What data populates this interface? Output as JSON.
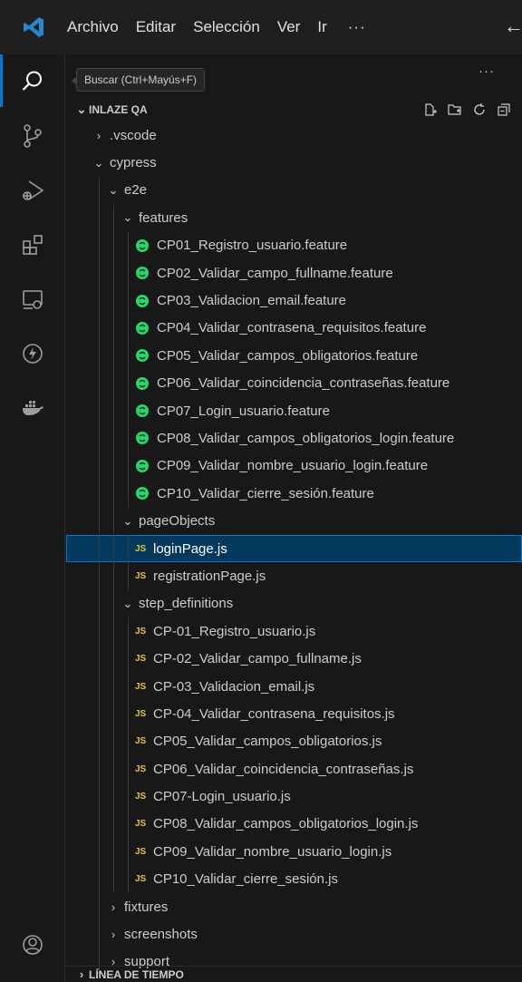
{
  "menu": {
    "items": [
      "Archivo",
      "Editar",
      "Selección",
      "Ver",
      "Ir"
    ],
    "more": "···"
  },
  "tooltip": "Buscar (Ctrl+Mayús+F)",
  "sidebar_more": "···",
  "explorer": {
    "title": "INLAZE QA",
    "rows": [
      {
        "label": ".vscode",
        "type": "folder",
        "expanded": false,
        "depth": 0
      },
      {
        "label": "cypress",
        "type": "folder",
        "expanded": true,
        "depth": 0
      },
      {
        "label": "e2e",
        "type": "folder",
        "expanded": true,
        "depth": 1
      },
      {
        "label": "features",
        "type": "folder",
        "expanded": true,
        "depth": 2
      },
      {
        "label": "CP01_Registro_usuario.feature",
        "type": "feature",
        "depth": 3
      },
      {
        "label": "CP02_Validar_campo_fullname.feature",
        "type": "feature",
        "depth": 3
      },
      {
        "label": "CP03_Validacion_email.feature",
        "type": "feature",
        "depth": 3
      },
      {
        "label": "CP04_Validar_contrasena_requisitos.feature",
        "type": "feature",
        "depth": 3
      },
      {
        "label": "CP05_Validar_campos_obligatorios.feature",
        "type": "feature",
        "depth": 3
      },
      {
        "label": "CP06_Validar_coincidencia_contraseñas.feature",
        "type": "feature",
        "depth": 3
      },
      {
        "label": "CP07_Login_usuario.feature",
        "type": "feature",
        "depth": 3
      },
      {
        "label": "CP08_Validar_campos_obligatorios_login.feature",
        "type": "feature",
        "depth": 3
      },
      {
        "label": "CP09_Validar_nombre_usuario_login.feature",
        "type": "feature",
        "depth": 3
      },
      {
        "label": "CP10_Validar_cierre_sesión.feature",
        "type": "feature",
        "depth": 3
      },
      {
        "label": "pageObjects",
        "type": "folder",
        "expanded": true,
        "depth": 2
      },
      {
        "label": "loginPage.js",
        "type": "js",
        "depth": 3,
        "selected": true
      },
      {
        "label": "registrationPage.js",
        "type": "js",
        "depth": 3
      },
      {
        "label": "step_definitions",
        "type": "folder",
        "expanded": true,
        "depth": 2
      },
      {
        "label": "CP-01_Registro_usuario.js",
        "type": "js",
        "depth": 3
      },
      {
        "label": "CP-02_Validar_campo_fullname.js",
        "type": "js",
        "depth": 3
      },
      {
        "label": "CP-03_Validacion_email.js",
        "type": "js",
        "depth": 3
      },
      {
        "label": "CP-04_Validar_contrasena_requisitos.js",
        "type": "js",
        "depth": 3
      },
      {
        "label": "CP05_Validar_campos_obligatorios.js",
        "type": "js",
        "depth": 3
      },
      {
        "label": "CP06_Validar_coincidencia_contraseñas.js",
        "type": "js",
        "depth": 3
      },
      {
        "label": "CP07-Login_usuario.js",
        "type": "js",
        "depth": 3
      },
      {
        "label": "CP08_Validar_campos_obligatorios_login.js",
        "type": "js",
        "depth": 3
      },
      {
        "label": "CP09_Validar_nombre_usuario_login.js",
        "type": "js",
        "depth": 3
      },
      {
        "label": "CP10_Validar_cierre_sesión.js",
        "type": "js",
        "depth": 3
      },
      {
        "label": "fixtures",
        "type": "folder",
        "expanded": false,
        "depth": 1
      },
      {
        "label": "screenshots",
        "type": "folder",
        "expanded": false,
        "depth": 1
      },
      {
        "label": "support",
        "type": "folder",
        "expanded": false,
        "depth": 1
      }
    ]
  },
  "timeline": {
    "title": "LÍNEA DE TIEMPO"
  },
  "js_badge": "JS",
  "colors": {
    "accent": "#0078d4",
    "selection": "#04395e",
    "feature_green": "#23d96c",
    "js_yellow": "#e8c436",
    "logo_blue": "#2489ca"
  }
}
